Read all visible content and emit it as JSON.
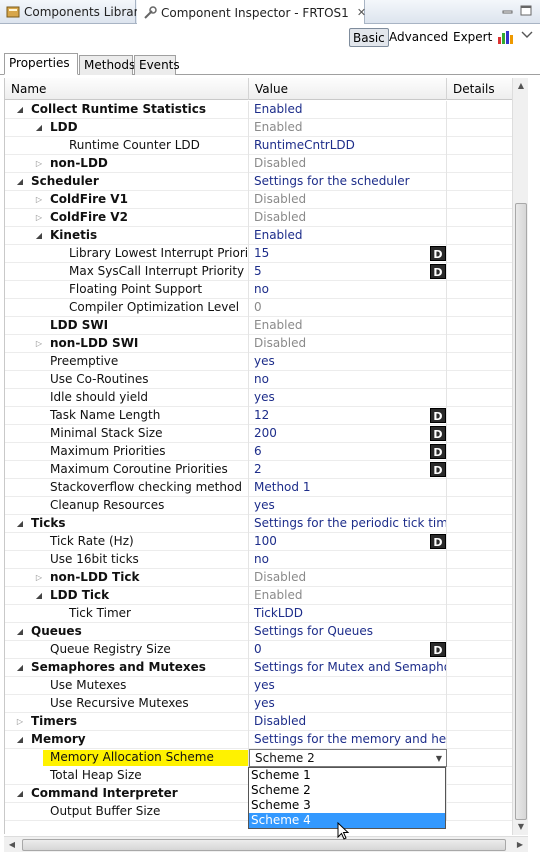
{
  "tabs": [
    {
      "label": "Components Library",
      "icon": "components-library-icon"
    },
    {
      "label": "Component Inspector - FRTOS1",
      "icon": "inspector-icon",
      "close": "✕"
    }
  ],
  "modes": {
    "basic": "Basic",
    "advanced": "Advanced",
    "expert": "Expert",
    "active": "Basic"
  },
  "panel_tabs": [
    "Properties",
    "Methods",
    "Events"
  ],
  "columns": {
    "name": "Name",
    "value": "Value",
    "details": "Details"
  },
  "rows": [
    {
      "level": 0,
      "twisty": "open",
      "name": "Collect Runtime Statistics",
      "bold": true,
      "value": "Enabled",
      "style": "enabled"
    },
    {
      "level": 1,
      "twisty": "open",
      "name": "LDD",
      "bold": true,
      "value": "Enabled",
      "style": "disabled"
    },
    {
      "level": 2,
      "name": "Runtime Counter LDD",
      "value": "RuntimeCntrLDD",
      "style": "enabled"
    },
    {
      "level": 1,
      "twisty": "closed",
      "name": "non-LDD",
      "bold": true,
      "value": "Disabled",
      "style": "disabled"
    },
    {
      "level": 0,
      "twisty": "open",
      "name": "Scheduler",
      "bold": true,
      "value": "Settings for the scheduler",
      "style": "enabled"
    },
    {
      "level": 1,
      "twisty": "closed",
      "name": "ColdFire V1",
      "bold": true,
      "value": "Disabled",
      "style": "disabled"
    },
    {
      "level": 1,
      "twisty": "closed",
      "name": "ColdFire V2",
      "bold": true,
      "value": "Disabled",
      "style": "disabled"
    },
    {
      "level": 1,
      "twisty": "open",
      "name": "Kinetis",
      "bold": true,
      "value": "Enabled",
      "style": "enabled"
    },
    {
      "level": 2,
      "name": "Library Lowest Interrupt Priority",
      "value": "15",
      "style": "enabled",
      "d": true
    },
    {
      "level": 2,
      "name": "Max SysCall Interrupt Priority",
      "value": "5",
      "style": "enabled",
      "d": true
    },
    {
      "level": 2,
      "name": "Floating Point Support",
      "value": "no",
      "style": "enabled"
    },
    {
      "level": 2,
      "name": "Compiler Optimization Level",
      "value": "0",
      "style": "disabled"
    },
    {
      "level": 1,
      "name": "LDD SWI",
      "bold": true,
      "value": "Enabled",
      "style": "disabled"
    },
    {
      "level": 1,
      "twisty": "closed",
      "name": "non-LDD SWI",
      "bold": true,
      "value": "Disabled",
      "style": "disabled"
    },
    {
      "level": 1,
      "name": "Preemptive",
      "value": "yes",
      "style": "enabled"
    },
    {
      "level": 1,
      "name": "Use Co-Routines",
      "value": "no",
      "style": "enabled"
    },
    {
      "level": 1,
      "name": "Idle should yield",
      "value": "yes",
      "style": "enabled"
    },
    {
      "level": 1,
      "name": "Task Name Length",
      "value": "12",
      "style": "enabled",
      "d": true
    },
    {
      "level": 1,
      "name": "Minimal Stack Size",
      "value": "200",
      "style": "enabled",
      "d": true
    },
    {
      "level": 1,
      "name": "Maximum Priorities",
      "value": "6",
      "style": "enabled",
      "d": true
    },
    {
      "level": 1,
      "name": "Maximum Coroutine Priorities",
      "value": "2",
      "style": "enabled",
      "d": true
    },
    {
      "level": 1,
      "name": "Stackoverflow checking method",
      "value": "Method 1",
      "style": "enabled"
    },
    {
      "level": 1,
      "name": "Cleanup Resources",
      "value": "yes",
      "style": "enabled"
    },
    {
      "level": 0,
      "twisty": "open",
      "name": "Ticks",
      "bold": true,
      "value": "Settings for the periodic tick timer",
      "style": "enabled"
    },
    {
      "level": 1,
      "name": "Tick Rate (Hz)",
      "value": "100",
      "style": "enabled",
      "d": true
    },
    {
      "level": 1,
      "name": "Use 16bit ticks",
      "value": "no",
      "style": "enabled"
    },
    {
      "level": 1,
      "twisty": "closed",
      "name": "non-LDD Tick",
      "bold": true,
      "value": "Disabled",
      "style": "disabled"
    },
    {
      "level": 1,
      "twisty": "open",
      "name": "LDD Tick",
      "bold": true,
      "value": "Enabled",
      "style": "disabled"
    },
    {
      "level": 2,
      "name": "Tick Timer",
      "value": "TickLDD",
      "style": "enabled"
    },
    {
      "level": 0,
      "twisty": "open",
      "name": "Queues",
      "bold": true,
      "value": "Settings for Queues",
      "style": "enabled"
    },
    {
      "level": 1,
      "name": "Queue Registry Size",
      "value": "0",
      "style": "enabled",
      "d": true
    },
    {
      "level": 0,
      "twisty": "open",
      "name": "Semaphores and Mutexes",
      "bold": true,
      "value": "Settings for Mutex and Semaphore",
      "style": "enabled"
    },
    {
      "level": 1,
      "name": "Use Mutexes",
      "value": "yes",
      "style": "enabled"
    },
    {
      "level": 1,
      "name": "Use Recursive Mutexes",
      "value": "yes",
      "style": "enabled"
    },
    {
      "level": 0,
      "twisty": "closed",
      "name": "Timers",
      "bold": true,
      "value": "Disabled",
      "style": "enabled"
    },
    {
      "level": 0,
      "twisty": "open",
      "name": "Memory",
      "bold": true,
      "value": "Settings for the memory and heap ...",
      "style": "enabled"
    },
    {
      "level": 1,
      "name": "Memory Allocation Scheme",
      "value": "Scheme 2",
      "style": "normal",
      "selected": true
    },
    {
      "level": 1,
      "name": "Total Heap Size",
      "value": "",
      "style": "enabled"
    },
    {
      "level": 0,
      "twisty": "open",
      "name": "Command Interpreter",
      "bold": true,
      "value": "",
      "style": "enabled"
    },
    {
      "level": 1,
      "name": "Output Buffer Size",
      "value": "",
      "style": "enabled"
    }
  ],
  "dropdown": {
    "options": [
      "Scheme 1",
      "Scheme 2",
      "Scheme 3",
      "Scheme 4"
    ],
    "hover_index": 3,
    "current": "Scheme 2"
  },
  "d_label": "D",
  "colors": {
    "enabled": "#1d2d8a",
    "disabled": "#8a8a8a",
    "highlight": "#fff200",
    "hover": "#3399ff"
  }
}
